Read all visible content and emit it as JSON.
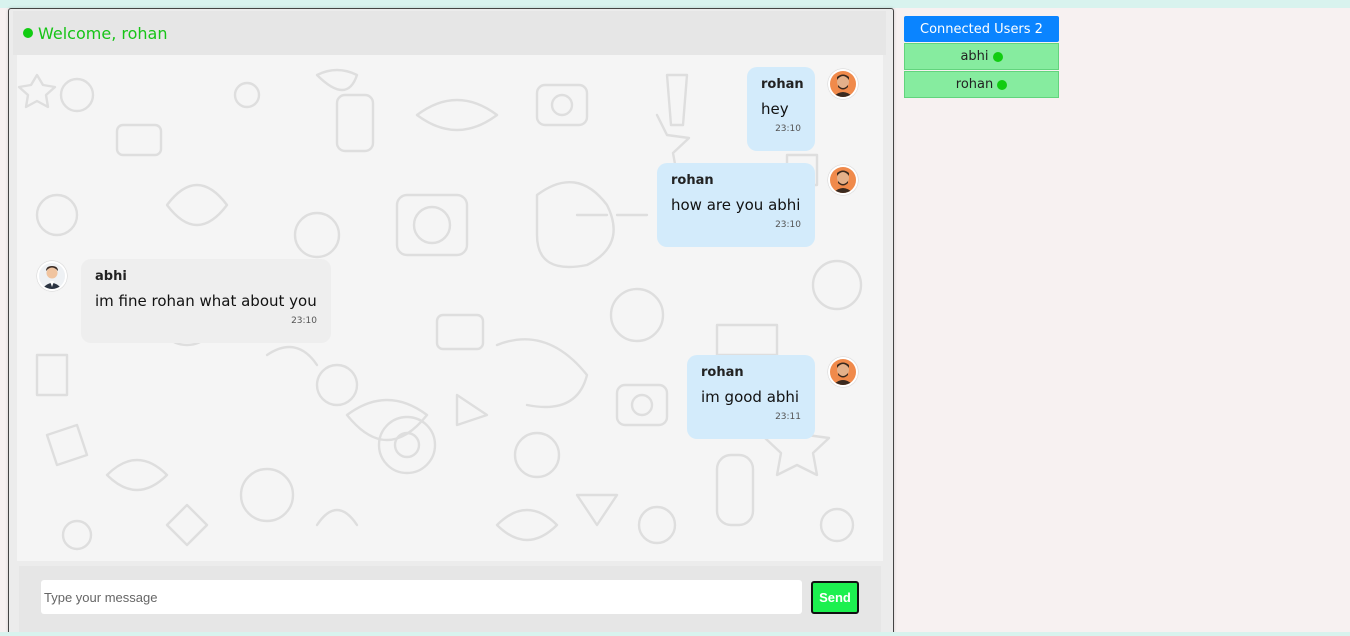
{
  "header": {
    "welcome": "Welcome, rohan",
    "status_color": "#11cc11"
  },
  "messages": [
    {
      "sender": "rohan",
      "text": "hey",
      "time": "23:10",
      "mine": true
    },
    {
      "sender": "rohan",
      "text": "how are you abhi",
      "time": "23:10",
      "mine": true
    },
    {
      "sender": "abhi",
      "text": "im fine rohan what about you",
      "time": "23:10",
      "mine": false
    },
    {
      "sender": "rohan",
      "text": "im good abhi",
      "time": "23:11",
      "mine": true
    }
  ],
  "composer": {
    "placeholder": "Type your message",
    "send_label": "Send"
  },
  "users": {
    "header": "Connected Users 2",
    "list": [
      {
        "name": "abhi",
        "online": true
      },
      {
        "name": "rohan",
        "online": true
      }
    ]
  },
  "colors": {
    "accent": "#0a84ff",
    "send": "#1cf04f",
    "user_bg": "#86ec9f",
    "bubble_mine": "#d3ebfb"
  },
  "icons": [
    "online-dot-icon",
    "rohan-avatar-icon",
    "abhi-avatar-icon"
  ]
}
